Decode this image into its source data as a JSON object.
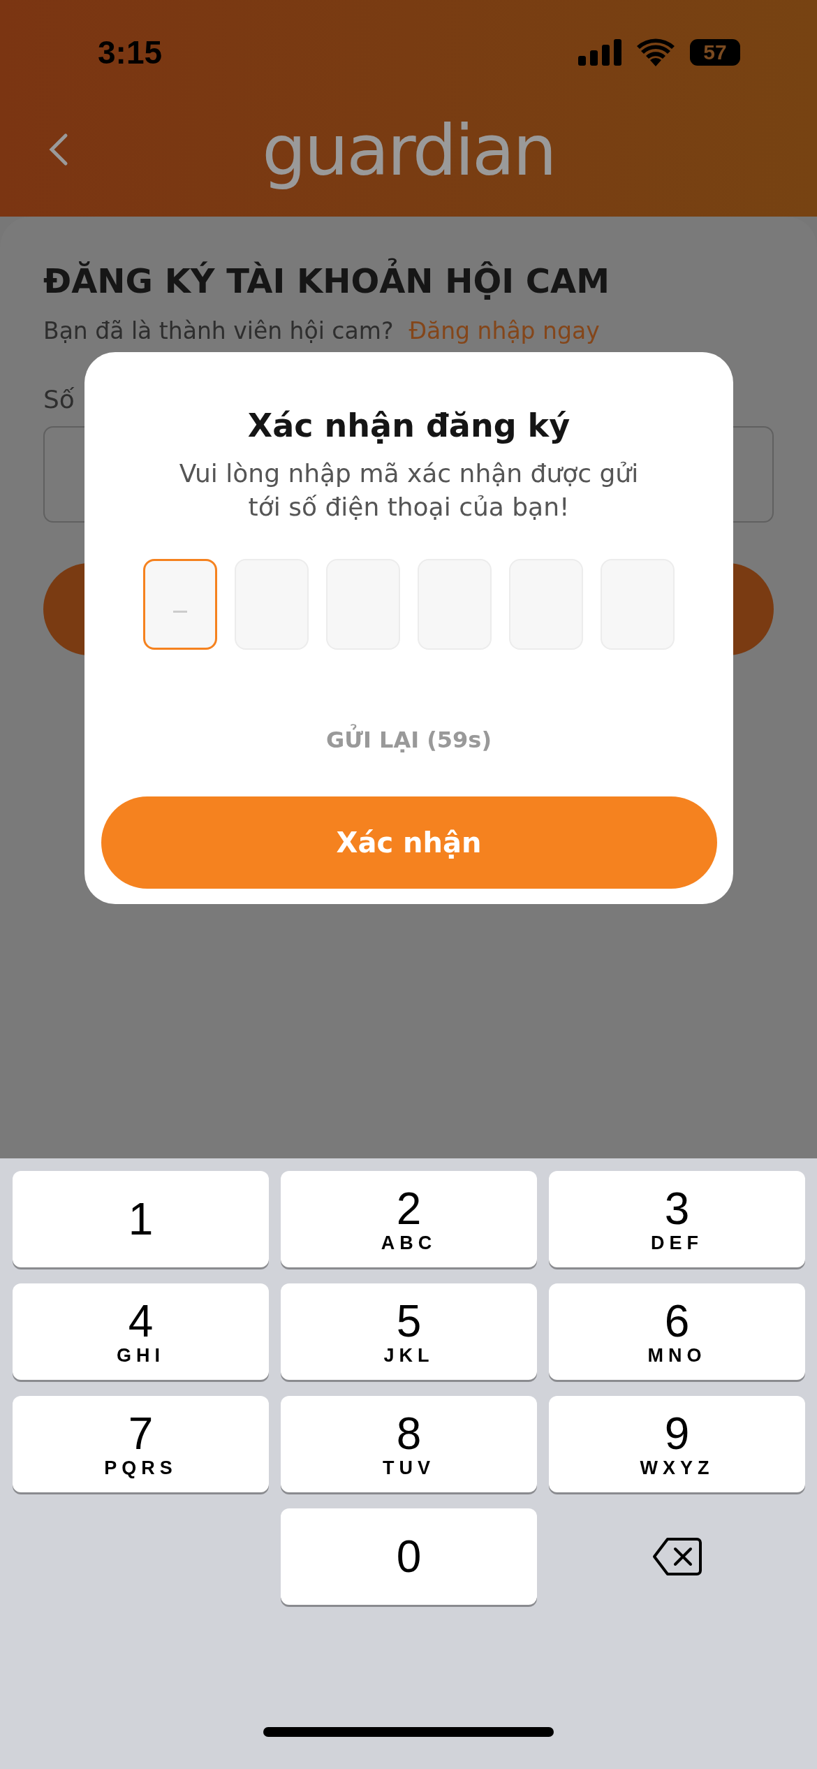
{
  "status_bar": {
    "time": "3:15",
    "battery": "57"
  },
  "header": {
    "logo": "guardian"
  },
  "form": {
    "title": "ĐĂNG KÝ TÀI KHOẢN HỘI CAM",
    "prompt": "Bạn đã là thành viên hội cam?",
    "login_link": "Đăng nhập ngay",
    "field_label": "Số"
  },
  "dialog": {
    "title": "Xác nhận đăng ký",
    "message": "Vui lòng nhập mã xác nhận được gửi tới số điện thoại của bạn!",
    "code_boxes": [
      {
        "selected": true
      },
      {
        "selected": false
      },
      {
        "selected": false
      },
      {
        "selected": false
      },
      {
        "selected": false
      },
      {
        "selected": false
      }
    ],
    "resend": "GỬI LẠI (59s)",
    "confirm_button": "Xác nhận"
  },
  "keypad": {
    "keys": [
      {
        "kind": "digit",
        "digit": "1"
      },
      {
        "kind": "digit",
        "digit": "2",
        "letters": "ABC"
      },
      {
        "kind": "digit",
        "digit": "3",
        "letters": "DEF"
      },
      {
        "kind": "digit",
        "digit": "4",
        "letters": "GHI"
      },
      {
        "kind": "digit",
        "digit": "5",
        "letters": "JKL"
      },
      {
        "kind": "digit",
        "digit": "6",
        "letters": "MNO"
      },
      {
        "kind": "digit",
        "digit": "7",
        "letters": "PQRS"
      },
      {
        "kind": "digit",
        "digit": "8",
        "letters": "TUV"
      },
      {
        "kind": "digit",
        "digit": "9",
        "letters": "WXYZ"
      },
      {
        "kind": "blank"
      },
      {
        "kind": "digit",
        "digit": "0"
      },
      {
        "kind": "delete"
      }
    ]
  }
}
